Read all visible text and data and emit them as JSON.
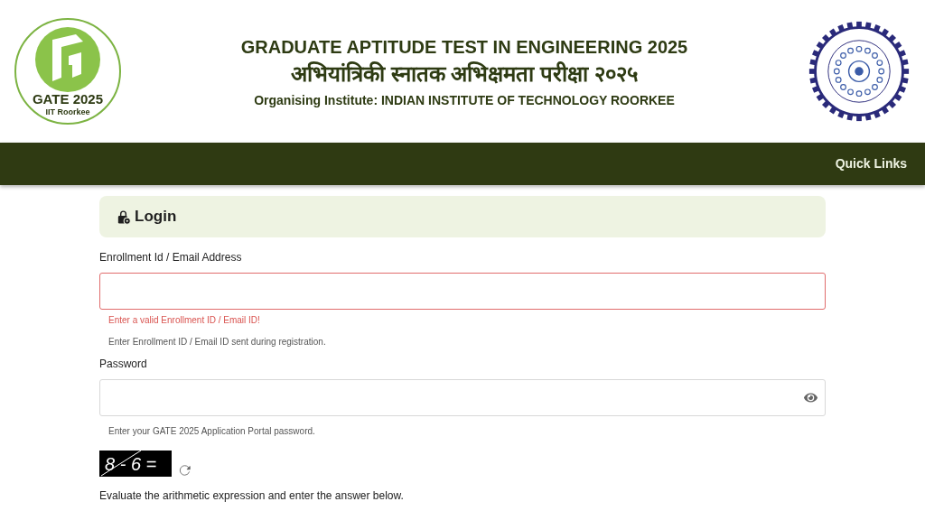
{
  "header": {
    "logo": {
      "title": "GATE 2025",
      "subtitle": "IIT Roorkee"
    },
    "title": "GRADUATE APTITUDE TEST IN ENGINEERING 2025",
    "title_hindi": "अभियांत्रिकी स्नातक अभिक्षमता परीक्षा २०२५",
    "organiser": "Organising Institute: INDIAN INSTITUTE OF TECHNOLOGY ROORKEE"
  },
  "navbar": {
    "links": [
      "Quick Links"
    ]
  },
  "login": {
    "heading": "Login",
    "fields": [
      {
        "kind": "text",
        "label": "Enrollment Id / Email Address",
        "invalid": true,
        "error": "Enter a valid Enrollment ID / Email ID!",
        "help": "Enter Enrollment ID / Email ID sent during registration."
      },
      {
        "kind": "password",
        "label": "Password",
        "invalid": false,
        "help": "Enter your GATE 2025 Application Portal password."
      }
    ],
    "captcha": {
      "expression": "8 - 6 =",
      "instruction": "Evaluate the arithmetic expression and enter the answer below."
    }
  }
}
